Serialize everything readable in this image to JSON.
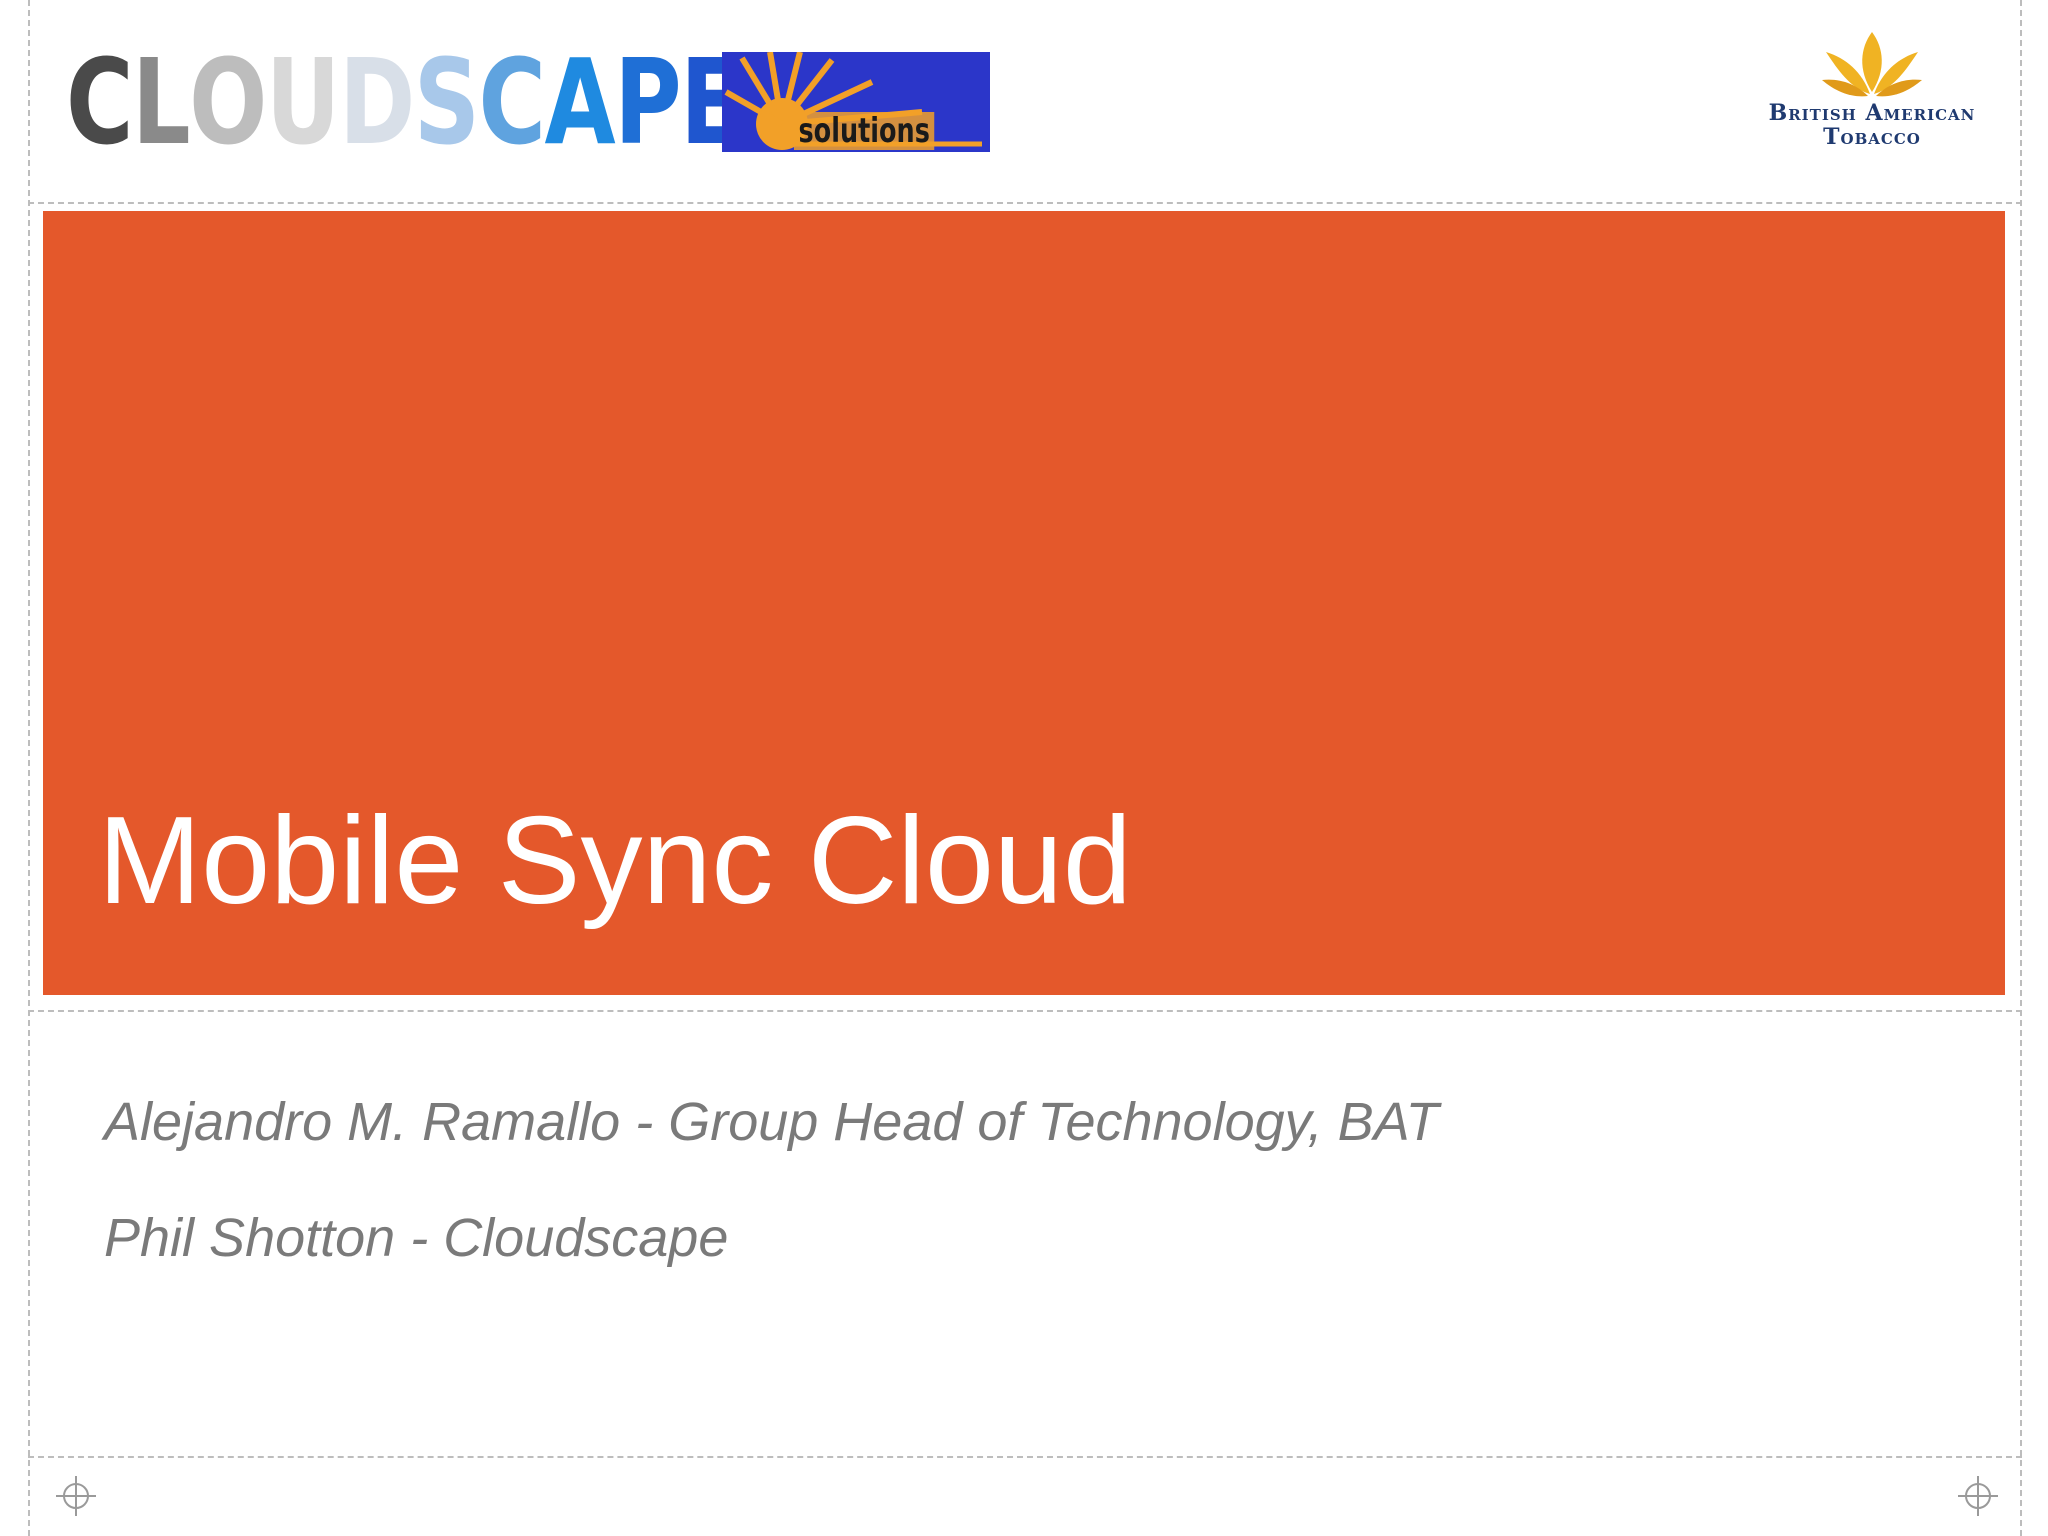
{
  "slide": {
    "title": "Mobile Sync Cloud",
    "subtitles": [
      "Alejandro M. Ramallo - Group Head of Technology, BAT",
      "Phil Shotton - Cloudscape"
    ]
  },
  "logos": {
    "left": {
      "word": "CLOUDSCAPE",
      "tagline": "solutions",
      "letter_colors": [
        "#4a4a4a",
        "#8a8a8a",
        "#bdbdbd",
        "#d8d8d8",
        "#d8dfe8",
        "#a8c8ea",
        "#5fa3df",
        "#1f8ae0",
        "#1f6fd6",
        "#1f56cf"
      ]
    },
    "right": {
      "line1": "British American",
      "line2": "Tobacco",
      "icon": "gold-leaf-icon"
    }
  },
  "colors": {
    "band": "#e4582b",
    "title_text": "#ffffff",
    "subtitle_text": "#7a7a7a",
    "bat_text": "#1f3a70",
    "bat_leaf": "#f0b323"
  }
}
